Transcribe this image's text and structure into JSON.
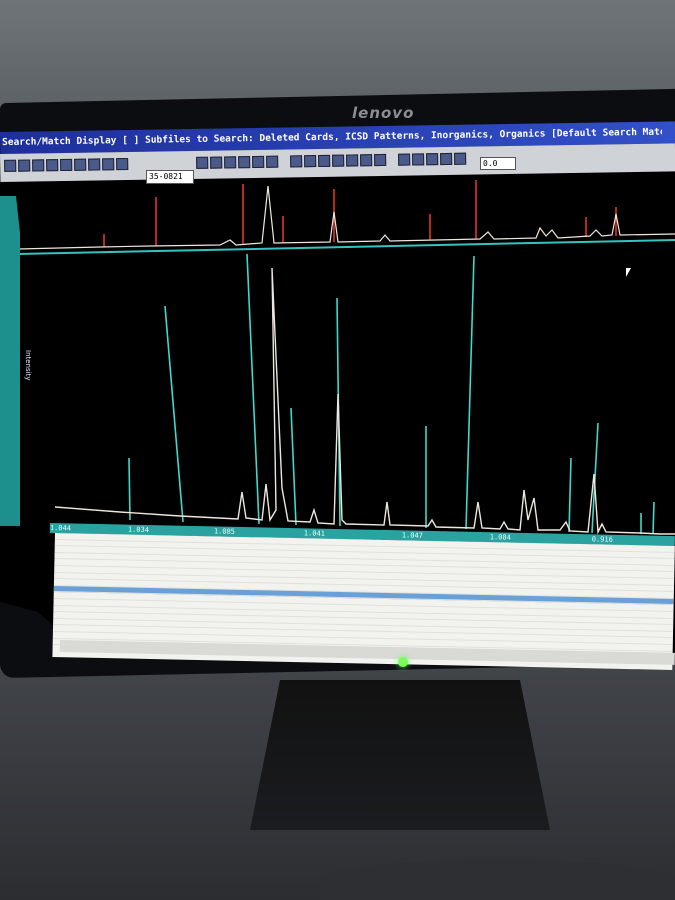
{
  "monitor": {
    "brand": "lenovo"
  },
  "window": {
    "title": "Search/Match Display [ ] Subfiles to Search: Deleted Cards, ICSD Patterns, Inorganics, Organics [Default Search Match]"
  },
  "toolbar": {
    "card_field": "35-0821",
    "zoom_field": "0.0"
  },
  "axis": {
    "ticks": [
      "1.044",
      "1.034",
      "1.085",
      "1.041",
      "1.047",
      "1.084",
      "0.916"
    ]
  },
  "sidebar": {
    "label": "Intensity"
  },
  "colors": {
    "plot_bg": "#000000",
    "reference_lines_red": "#e0342c",
    "reference_lines_cyan": "#40d8cc",
    "pattern_trace": "#f0e6dc",
    "title_bar": "#2a44b8",
    "axis_bar": "#2aa3a0",
    "power_led": "#7dff5a"
  },
  "icons": [
    "cursor-arrow-icon",
    "power-icon"
  ]
}
